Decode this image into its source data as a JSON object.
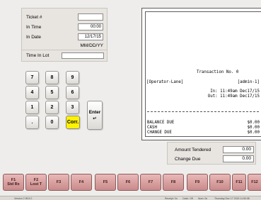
{
  "ticket": {
    "ticket_label": "Ticket #",
    "ticket_value": "",
    "time_in_label": "In Time",
    "time_in_value": "00:00",
    "date_in_label": "In Date",
    "date_in_value": "12/17/15",
    "date_format": "MM/DD/YY",
    "time_in_lot_label": "Time In Lot",
    "time_in_lot_value": ""
  },
  "keypad": {
    "keys": [
      "7",
      "8",
      "9",
      "4",
      "5",
      "6",
      "1",
      "2",
      "3",
      ".",
      "0"
    ],
    "corr_label": "Corr.",
    "enter_label": "Enter",
    "enter_symbol": "↵",
    "corr_color": "#fff200"
  },
  "receipt": {
    "title": "Transaction No. 0",
    "operator": "[Operator-Lane]",
    "user": "[admin-1]",
    "in_line": "In: 11:49am Dec17/15",
    "out_line": "Out: 11:49am Dec17/15",
    "lines": [
      {
        "label": "BALANCE DUE",
        "value": "$0.00"
      },
      {
        "label": "CASH",
        "value": "$0.00"
      },
      {
        "label": "CHANGE DUE",
        "value": "$0.00"
      }
    ]
  },
  "tender": {
    "amount_tendered_label": "Amount Tendered",
    "amount_tendered_value": "0.00",
    "change_due_label": "Change Due",
    "change_due_value": "0.00"
  },
  "function_keys": [
    {
      "top": "F1",
      "bottom": "Std Rx"
    },
    {
      "top": "F2",
      "bottom": "Lost T"
    },
    {
      "top": "F3",
      "bottom": ""
    },
    {
      "top": "F4",
      "bottom": ""
    },
    {
      "top": "F5",
      "bottom": ""
    },
    {
      "top": "F6",
      "bottom": ""
    },
    {
      "top": "F7",
      "bottom": ""
    },
    {
      "top": "F8",
      "bottom": ""
    },
    {
      "top": "F9",
      "bottom": ""
    },
    {
      "top": "F10",
      "bottom": ""
    },
    {
      "top": "F11",
      "bottom": ""
    },
    {
      "top": "F12",
      "bottom": ""
    }
  ],
  "function_key_color": "#d9a3a3",
  "status_bar": {
    "version": "Version 2.95.5.0",
    "receipt": "Receipt: 0n",
    "cash_drawer": "Cash: Off",
    "num": "Num: 0n",
    "datetime": "Thursday Dec 17 2015  11:50:08"
  }
}
